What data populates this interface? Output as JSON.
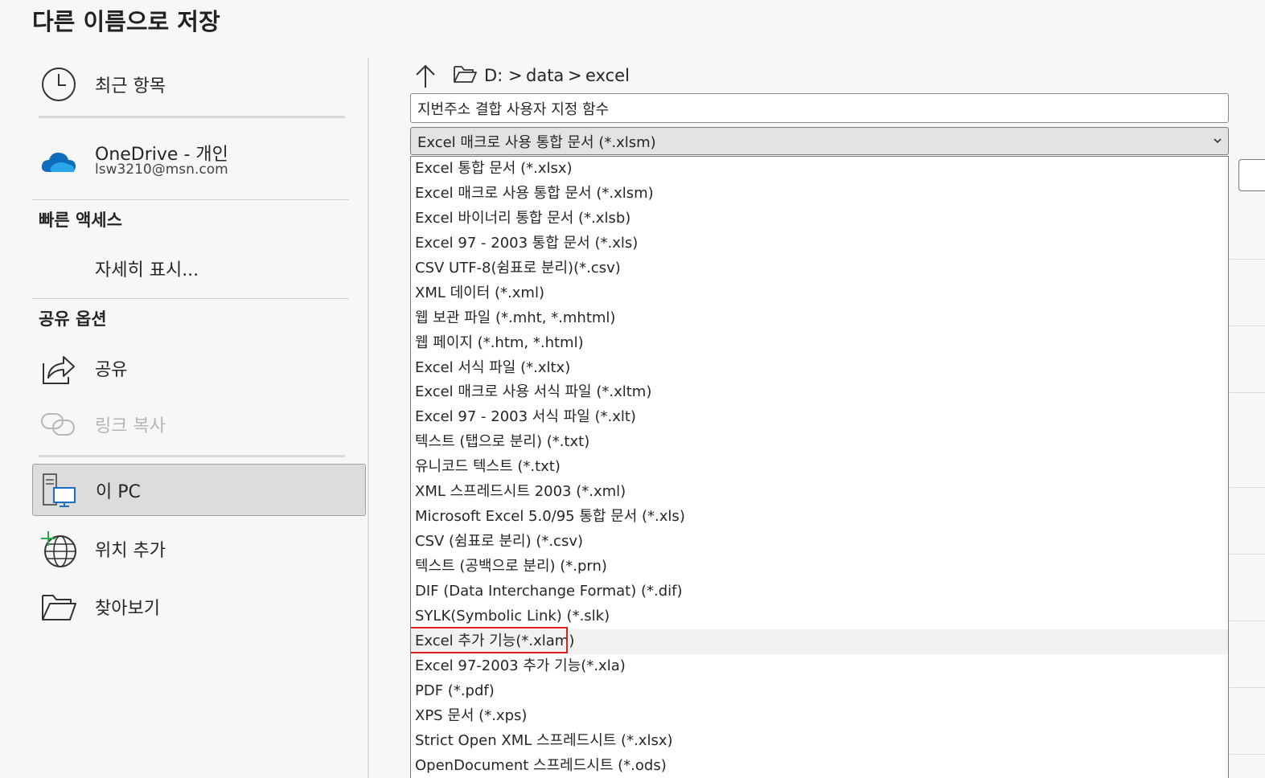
{
  "page_title": "다른 이름으로 저장",
  "nav": {
    "recent": "최근 항목",
    "onedrive_name": "OneDrive - 개인",
    "onedrive_email": "lsw3210@msn.com",
    "quick_access_title": "빠른 액세스",
    "show_more": "자세히 표시...",
    "share_options_title": "공유 옵션",
    "share": "공유",
    "copy_link": "링크 복사",
    "this_pc": "이 PC",
    "add_location": "위치 추가",
    "browse": "찾아보기"
  },
  "breadcrumb": {
    "drive": "D:",
    "sep": ">",
    "folder1": "data",
    "folder2": "excel"
  },
  "filename": "지번주소 결합 사용자 지정 함수",
  "file_type": {
    "selected": "Excel 매크로 사용 통합 문서 (*.xlsm)",
    "options": [
      "Excel 통합 문서 (*.xlsx)",
      "Excel 매크로 사용 통합 문서 (*.xlsm)",
      "Excel 바이너리 통합 문서 (*.xlsb)",
      "Excel 97 - 2003 통합 문서 (*.xls)",
      "CSV UTF-8(쉼표로 분리)(*.csv)",
      "XML 데이터 (*.xml)",
      "웹 보관 파일 (*.mht, *.mhtml)",
      "웹 페이지 (*.htm, *.html)",
      "Excel 서식 파일 (*.xltx)",
      "Excel 매크로 사용 서식 파일 (*.xltm)",
      "Excel 97 - 2003 서식 파일 (*.xlt)",
      "텍스트 (탭으로 분리) (*.txt)",
      "유니코드 텍스트 (*.txt)",
      "XML 스프레드시트 2003 (*.xml)",
      "Microsoft Excel 5.0/95 통합 문서 (*.xls)",
      "CSV (쉼표로 분리) (*.csv)",
      "텍스트 (공백으로 분리) (*.prn)",
      "DIF (Data Interchange Format) (*.dif)",
      "SYLK(Symbolic Link) (*.slk)",
      "Excel 추가 기능(*.xlam)",
      "Excel 97-2003 추가 기능(*.xla)",
      "PDF (*.pdf)",
      "XPS 문서 (*.xps)",
      "Strict Open XML 스프레드시트 (*.xlsx)",
      "OpenDocument 스프레드시트 (*.ods)"
    ],
    "highlighted_index": 19
  },
  "colors": {
    "highlight_border": "#e02020",
    "selected_nav_bg": "#dcdcdc",
    "onedrive_blue": "#0f6cbd"
  },
  "icons": [
    "clock-icon",
    "onedrive-cloud-icon",
    "share-icon",
    "link-icon",
    "computer-icon",
    "globe-add-icon",
    "folder-open-icon",
    "arrow-up-icon",
    "chevron-down-icon"
  ]
}
